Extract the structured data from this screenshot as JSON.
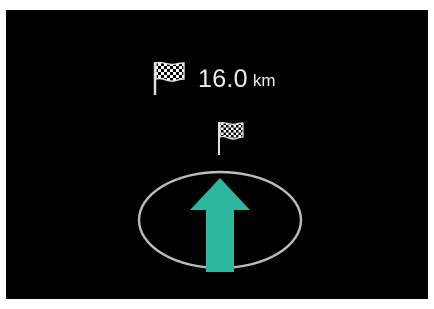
{
  "route": {
    "distance_value": "16.0",
    "distance_unit": "km",
    "flag_icon": "checkered-flag-icon"
  },
  "maneuver": {
    "direction": "straight",
    "arrow_icon": "straight-arrow-icon",
    "arrow_color": "#2db79c",
    "ring_color": "#bcbcbc"
  },
  "colors": {
    "background": "#000000",
    "text": "#ededed"
  }
}
